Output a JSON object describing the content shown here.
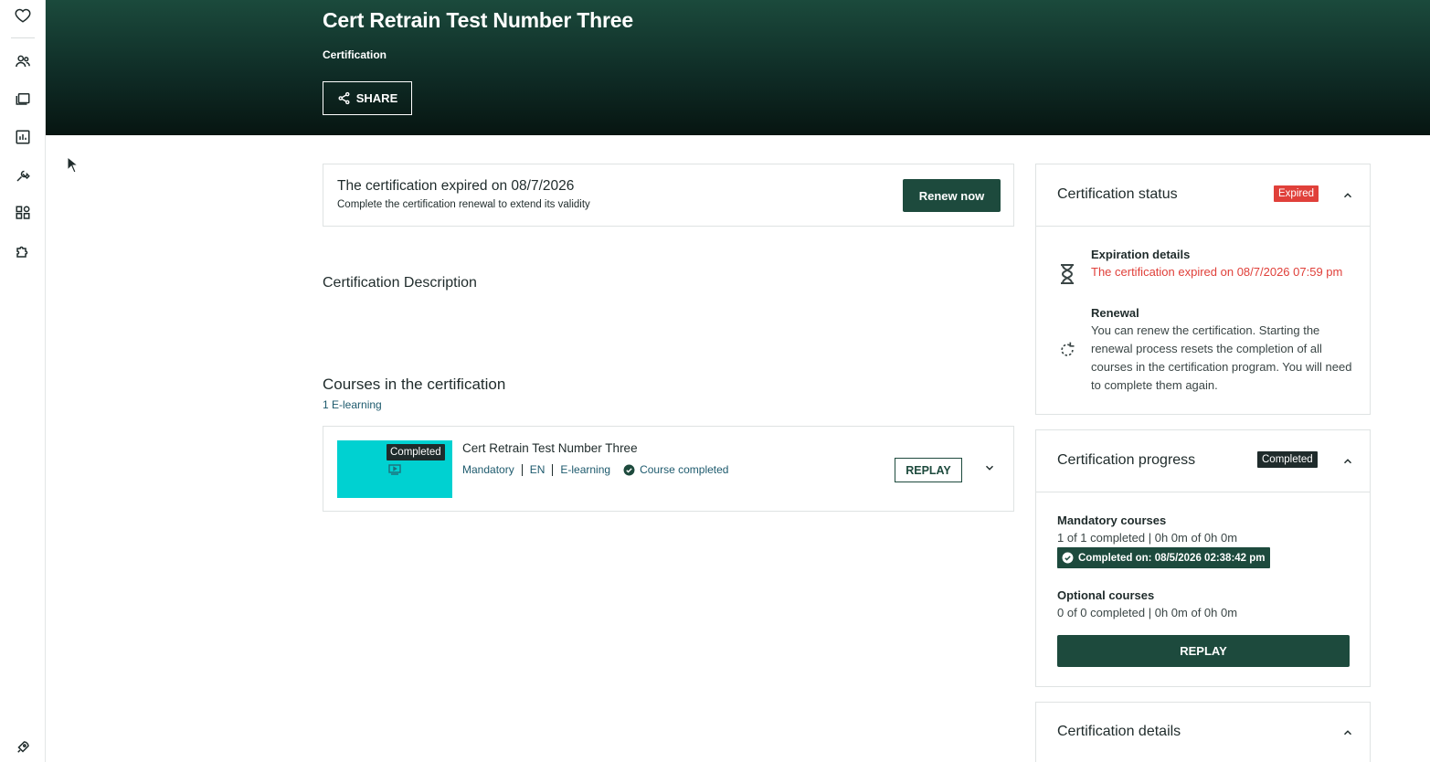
{
  "rail": {
    "icons": [
      "heart-icon",
      "users-icon",
      "library-icon",
      "chart-icon",
      "tools-icon",
      "apps-icon",
      "puzzle-icon",
      "rocket-icon"
    ]
  },
  "header": {
    "title": "Cert Retrain Test Number Three",
    "subtitle": "Certification",
    "share_label": "SHARE"
  },
  "expiry_banner": {
    "title": "The certification expired on 08/7/2026",
    "subtitle": "Complete the certification renewal to extend its validity",
    "renew_label": "Renew now"
  },
  "description": {
    "heading": "Certification Description"
  },
  "courses": {
    "heading": "Courses in the certification",
    "count": "1 E-learning",
    "items": [
      {
        "badge": "Completed",
        "title": "Cert Retrain Test Number Three",
        "type": "Mandatory",
        "language": "EN",
        "format": "E-learning",
        "status": "Course completed",
        "replay_label": "REPLAY",
        "thumb_color": "#00d1d1"
      }
    ]
  },
  "status_panel": {
    "title": "Certification status",
    "badge": "Expired",
    "expiration_label": "Expiration details",
    "expiration_text": "The certification expired on 08/7/2026 07:59 pm",
    "renewal_label": "Renewal",
    "renewal_text": "You can renew the certification. Starting the renewal process resets the completion of all courses in the certification program. You will need to complete them again."
  },
  "progress_panel": {
    "title": "Certification progress",
    "badge": "Completed",
    "mandatory_label": "Mandatory courses",
    "mandatory_text": "1 of 1 completed | 0h 0m of 0h 0m",
    "completed_on": "Completed on: 08/5/2026 02:38:42 pm",
    "optional_label": "Optional courses",
    "optional_text": "0 of 0 completed | 0h 0m of 0h 0m",
    "replay_label": "REPLAY"
  },
  "details_panel": {
    "title": "Certification details"
  },
  "colors": {
    "primary": "#1d4a3d",
    "danger": "#e0403a",
    "accent_link": "#1d5a6d",
    "thumb": "#00d1d1"
  }
}
